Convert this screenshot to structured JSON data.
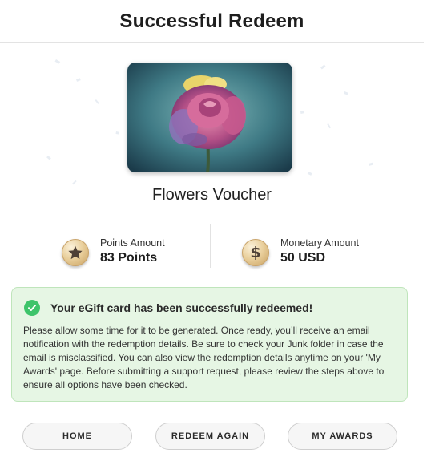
{
  "header": {
    "title": "Successful Redeem"
  },
  "voucher": {
    "name": "Flowers Voucher",
    "image_subject": "rose"
  },
  "stats": {
    "points": {
      "label": "Points Amount",
      "value": "83 Points",
      "icon": "star-coin-icon"
    },
    "monetary": {
      "label": "Monetary Amount",
      "value": "50 USD",
      "icon": "dollar-coin-icon"
    }
  },
  "success": {
    "title": "Your eGift card has been successfully redeemed!",
    "body": "Please allow some time for it to be generated. Once ready, you’ll receive an email notification with the redemption details. Be sure to check your Junk folder in case the email is misclassified. You can also view the redemption details anytime on your 'My Awards' page. Before submitting a support request, please review the steps above to ensure all options have been checked.",
    "icon": "check-circle-icon"
  },
  "buttons": {
    "home": "HOME",
    "redeem_again": "REDEEM AGAIN",
    "my_awards": "MY AWARDS"
  },
  "colors": {
    "success_bg": "#e6f6e4",
    "success_border": "#bfe5bb",
    "check_green": "#3ec46a",
    "coin_gold": "#e9cf9c"
  }
}
